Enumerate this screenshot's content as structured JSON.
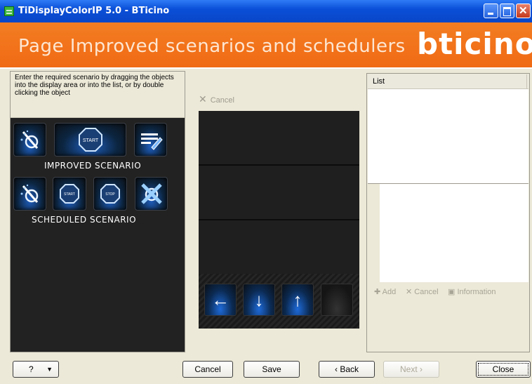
{
  "window": {
    "title": "TiDisplayColorIP 5.0 - BTicino"
  },
  "header": {
    "page_title": "Page Improved scenarios and schedulers",
    "logo": "bticino"
  },
  "left_panel": {
    "instructions": "Enter the required scenario by dragging the objects into the display area or into the list, or by double clicking the object",
    "improved_label": "IMPROVED SCENARIO",
    "scheduled_label": "SCHEDULED SCENARIO",
    "improved_icons": [
      "scenario-wand-icon",
      "start-button-icon",
      "edit-pen-icon"
    ],
    "scheduled_icons": [
      "scenario-wand-icon",
      "start-icon",
      "stop-icon",
      "disable-scenario-icon"
    ],
    "start_text": "START",
    "stop_text": "STOP"
  },
  "display": {
    "cancel_label": "Cancel",
    "arrows": [
      "arrow-left-icon",
      "arrow-down-icon",
      "arrow-up-icon",
      "blank"
    ]
  },
  "list_panel": {
    "header": "List",
    "add_label": "Add",
    "cancel_label": "Cancel",
    "info_label": "Information"
  },
  "bottom": {
    "help": "?",
    "cancel": "Cancel",
    "save": "Save",
    "back": "‹ Back",
    "next": "Next ›",
    "close": "Close"
  },
  "colors": {
    "header_orange": "#f37d22",
    "titlebar_blue": "#0a4fd8",
    "panel_dark": "#222222"
  }
}
